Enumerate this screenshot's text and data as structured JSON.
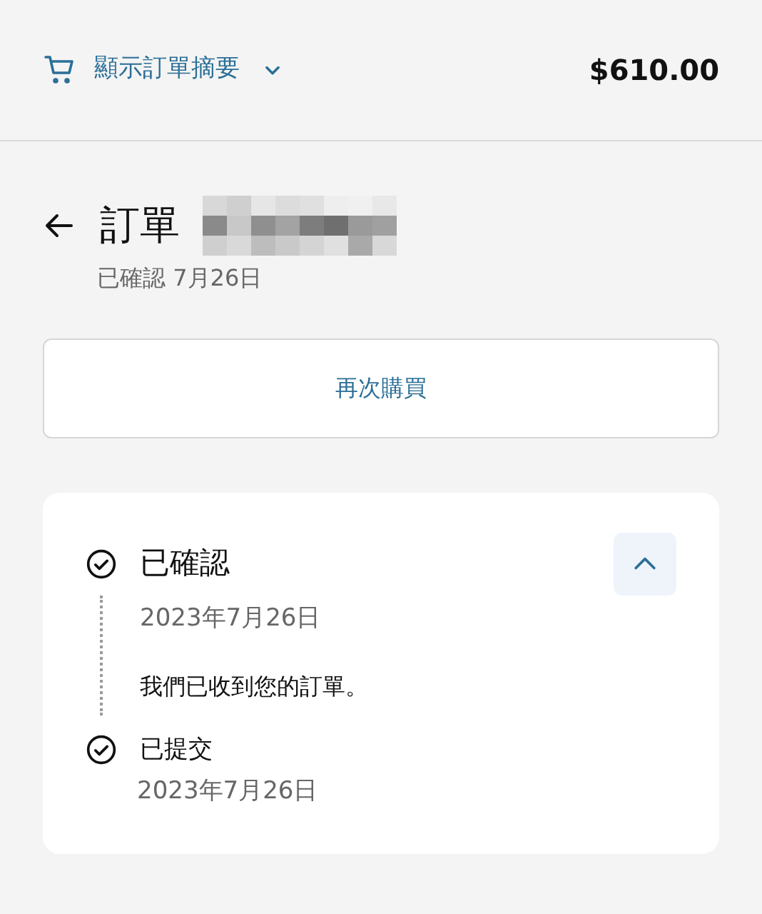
{
  "header": {
    "summary_link": "顯示訂單摘要",
    "summary_expanded": false,
    "total": "$610.00"
  },
  "order": {
    "title": "訂單",
    "status_line": "已確認 7月26日"
  },
  "buy_again": "再次購買",
  "timeline": {
    "expanded": true,
    "events": [
      {
        "kind": "current",
        "title": "已確認",
        "date": "2023年7月26日",
        "message": "我們已收到您的訂單。"
      },
      {
        "kind": "past",
        "title": "已提交",
        "date": "2023年7月26日"
      }
    ]
  }
}
